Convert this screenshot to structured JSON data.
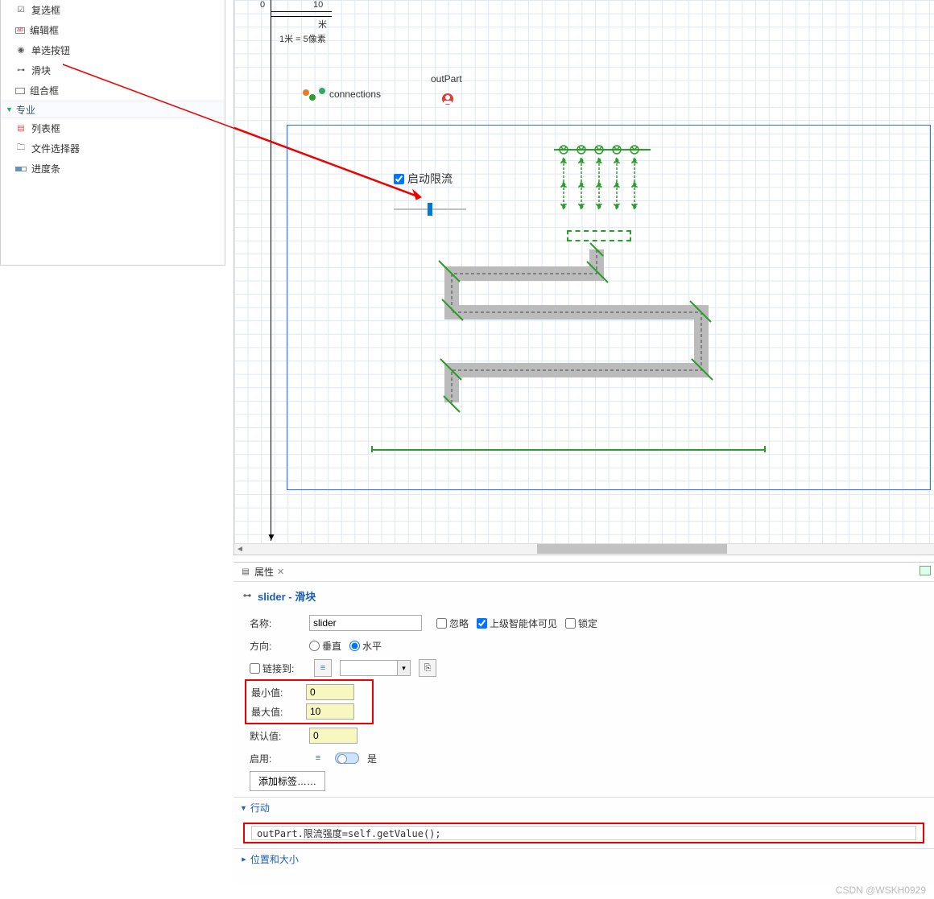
{
  "sidebar": {
    "items": [
      {
        "label": "复选框"
      },
      {
        "label": "编辑框"
      },
      {
        "label": "单选按钮"
      },
      {
        "label": "滑块"
      },
      {
        "label": "组合框"
      }
    ],
    "section": "专业",
    "pro_items": [
      {
        "label": "列表框"
      },
      {
        "label": "文件选择器"
      },
      {
        "label": "进度条"
      }
    ]
  },
  "canvas": {
    "ruler_zero": "0",
    "ruler_ten": "10",
    "ruler_unit": "米",
    "scale_text": "1米 = 5像素",
    "connections_label": "connections",
    "outpart_label": "outPart",
    "checkbox_label": "启动限流"
  },
  "properties": {
    "tab_label": "属性",
    "title": "slider - 滑块",
    "name_label": "名称:",
    "name_value": "slider",
    "ignore_label": "忽略",
    "visible_label": "上级智能体可见",
    "lock_label": "锁定",
    "orient_label": "方向:",
    "orient_v": "垂直",
    "orient_h": "水平",
    "link_label": "链接到:",
    "min_label": "最小值:",
    "min_value": "0",
    "max_label": "最大值:",
    "max_value": "10",
    "default_label": "默认值:",
    "default_value": "0",
    "enable_label": "启用:",
    "enable_yes": "是",
    "add_label_btn": "添加标签……",
    "action_section": "行动",
    "code": "outPart.限流强度=self.getValue();",
    "pos_section": "位置和大小"
  },
  "watermark": "CSDN @WSKH0929"
}
